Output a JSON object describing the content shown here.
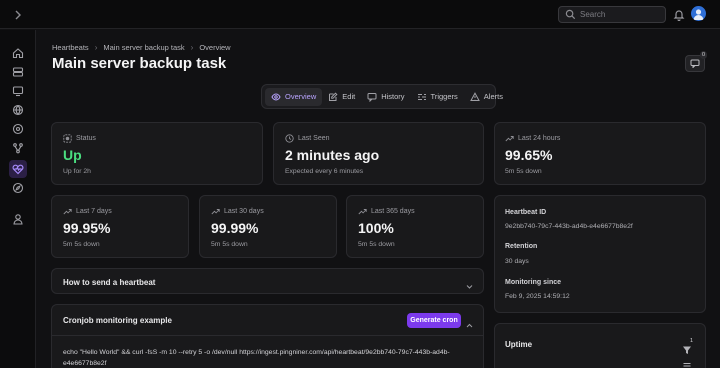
{
  "topbar": {
    "search_placeholder": "Search"
  },
  "breadcrumb": [
    "Heartbeats",
    "Main server backup task",
    "Overview"
  ],
  "page_title": "Main server backup task",
  "notifications": {
    "count": "0"
  },
  "tabs": [
    {
      "label": "Overview",
      "icon": "eye-icon",
      "active": true
    },
    {
      "label": "Edit",
      "icon": "edit-icon"
    },
    {
      "label": "History",
      "icon": "message-icon"
    },
    {
      "label": "Triggers",
      "icon": "triggers-icon"
    },
    {
      "label": "Alerts",
      "icon": "alert-icon"
    }
  ],
  "status": {
    "label": "Status",
    "value": "Up",
    "sub": "Up for 2h",
    "color": "#4ade80"
  },
  "last_seen": {
    "label": "Last Seen",
    "value": "2 minutes ago",
    "sub": "Expected every 6 minutes"
  },
  "last_24h": {
    "label": "Last 24 hours",
    "value": "99.65%",
    "sub": "5m 5s down"
  },
  "last_7d": {
    "label": "Last 7 days",
    "value": "99.95%",
    "sub": "5m 5s down"
  },
  "last_30d": {
    "label": "Last 30 days",
    "value": "99.99%",
    "sub": "5m 5s down"
  },
  "last_365d": {
    "label": "Last 365 days",
    "value": "100%",
    "sub": "5m 5s down"
  },
  "info": {
    "heartbeat_id_label": "Heartbeat ID",
    "heartbeat_id": "9e2bb740-79c7-443b-ad4b-e4e6677b8e2f",
    "retention_label": "Retention",
    "retention": "30 days",
    "monitoring_since_label": "Monitoring since",
    "monitoring_since": "Feb 9, 2025 14:59:12"
  },
  "how_to": {
    "title": "How to send a heartbeat"
  },
  "cron": {
    "title": "Cronjob monitoring example",
    "button": "Generate cron",
    "code_line1": "echo \"Hello World\" && curl -fsS -m 10 --retry 5 -o /dev/null https://ingest.pingniner.com/api/heartbeat/9e2bb740-79c7-443b-ad4b-",
    "code_line2": "e4e6677b8e2f"
  },
  "uptime": {
    "title": "Uptime",
    "filter_count": "1"
  },
  "colors": {
    "accent": "#7c3aed",
    "success": "#4ade80",
    "background": "#111113",
    "card": "#19191b"
  }
}
